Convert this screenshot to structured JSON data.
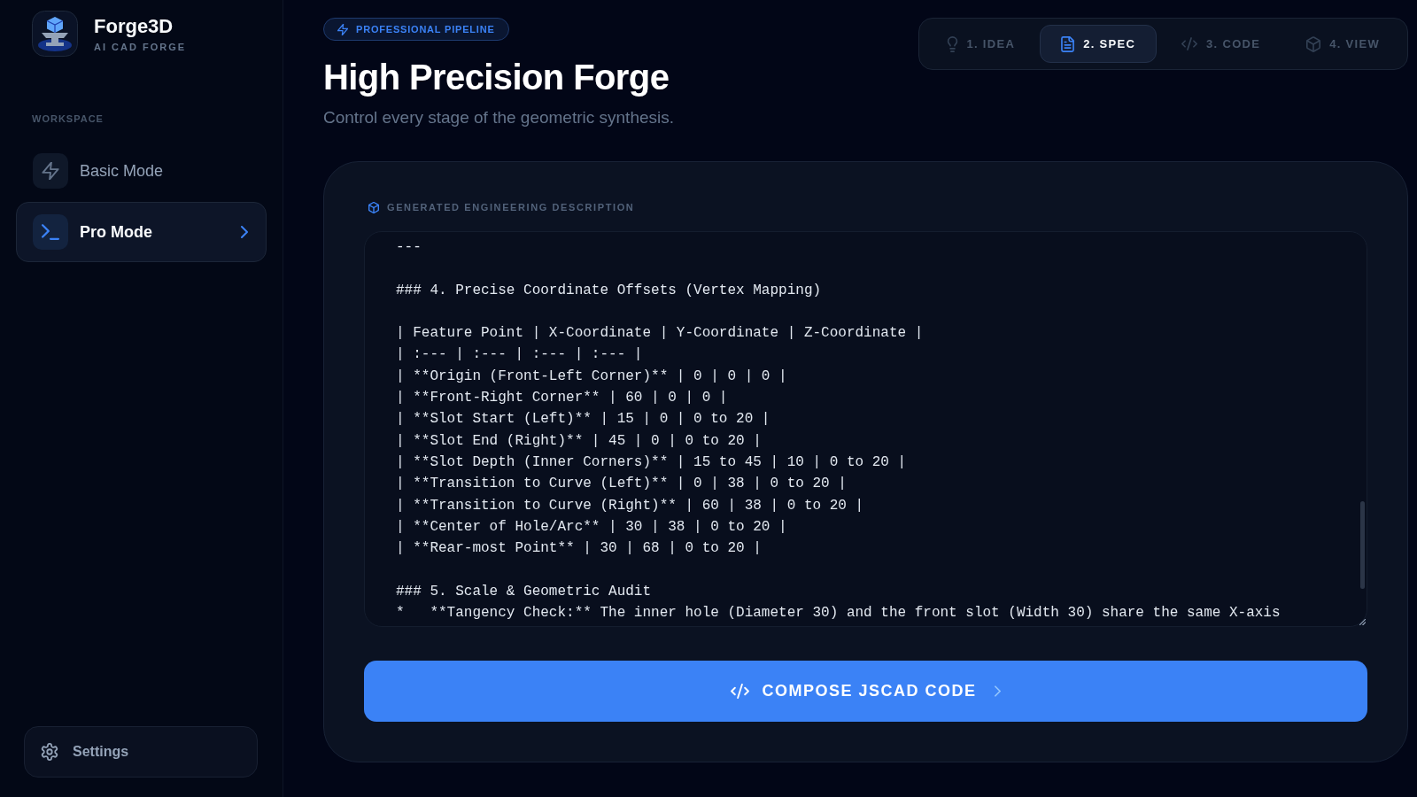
{
  "sidebar": {
    "brand": {
      "name": "Forge3D",
      "tagline": "AI CAD FORGE"
    },
    "section_label": "WORKSPACE",
    "items": [
      {
        "label": "Basic Mode",
        "selected": false
      },
      {
        "label": "Pro Mode",
        "selected": true
      }
    ],
    "settings": {
      "label": "Settings"
    }
  },
  "header": {
    "badge": "PROFESSIONAL PIPELINE",
    "title": "High Precision Forge",
    "subtitle": "Control every stage of the geometric synthesis."
  },
  "steps": [
    {
      "label": "1. IDEA",
      "selected": false
    },
    {
      "label": "2. SPEC",
      "selected": true
    },
    {
      "label": "3. CODE",
      "selected": false
    },
    {
      "label": "4. VIEW",
      "selected": false
    }
  ],
  "description": {
    "label": "GENERATED ENGINEERING DESCRIPTION",
    "value": "---\n\n### 4. Precise Coordinate Offsets (Vertex Mapping)\n\n| Feature Point | X-Coordinate | Y-Coordinate | Z-Coordinate |\n| :--- | :--- | :--- | :--- |\n| **Origin (Front-Left Corner)** | 0 | 0 | 0 |\n| **Front-Right Corner** | 60 | 0 | 0 |\n| **Slot Start (Left)** | 15 | 0 | 0 to 20 |\n| **Slot End (Right)** | 45 | 0 | 0 to 20 |\n| **Slot Depth (Inner Corners)** | 15 to 45 | 10 | 0 to 20 |\n| **Transition to Curve (Left)** | 0 | 38 | 0 to 20 |\n| **Transition to Curve (Right)** | 60 | 38 | 0 to 20 |\n| **Center of Hole/Arc** | 30 | 38 | 0 to 20 |\n| **Rear-most Point** | 30 | 68 | 0 to 20 |\n\n### 5. Scale & Geometric Audit\n*   **Tangency Check:** The inner hole (Diameter 30) and the front slot (Width 30) share the same X-axis"
  },
  "compose_button": {
    "label": "COMPOSE JSCAD CODE"
  }
}
